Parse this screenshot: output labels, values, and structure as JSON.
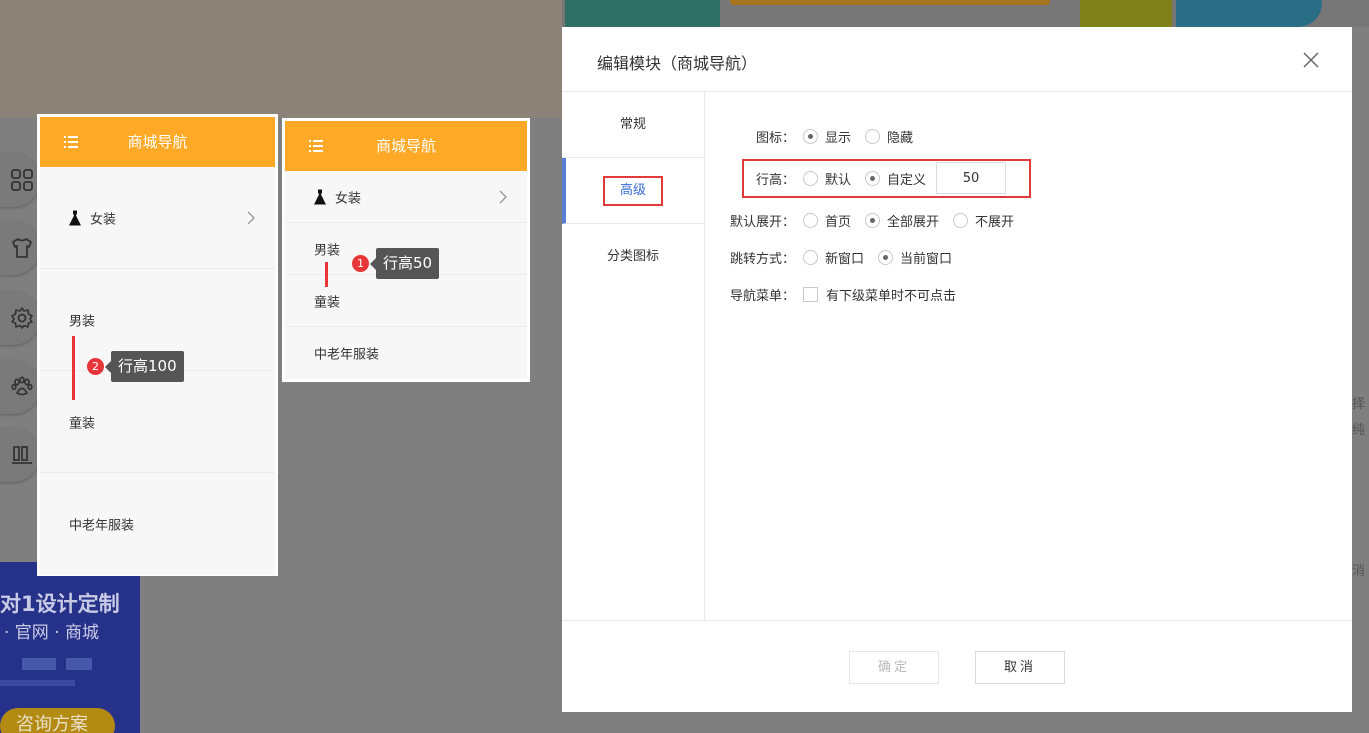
{
  "background": {
    "promo_title": "对1设计定制",
    "promo_sub": "· 官网    · 商城",
    "promo_button": "咨询方案",
    "edge_text": [
      "择",
      "纯",
      "消"
    ]
  },
  "preview_large": {
    "title": "商城导航",
    "items": [
      {
        "label": "女装",
        "has_icon": true,
        "has_arrow": true
      },
      {
        "label": "男装"
      },
      {
        "label": "童装"
      },
      {
        "label": "中老年服装"
      }
    ],
    "callout_num": "2",
    "callout_text": "行高100"
  },
  "preview_small": {
    "title": "商城导航",
    "items": [
      {
        "label": "女装",
        "has_icon": true,
        "has_arrow": true
      },
      {
        "label": "男装"
      },
      {
        "label": "童装"
      },
      {
        "label": "中老年服装"
      }
    ],
    "callout_num": "1",
    "callout_text": "行高50"
  },
  "dialog": {
    "title": "编辑模块（商城导航）",
    "tabs": [
      {
        "label": "常规",
        "active": false
      },
      {
        "label": "高级",
        "active": true
      },
      {
        "label": "分类图标",
        "active": false
      }
    ],
    "form": {
      "icon": {
        "label": "图标：",
        "options": [
          "显示",
          "隐藏"
        ],
        "selected": "显示"
      },
      "row_height": {
        "label": "行高：",
        "options": [
          "默认",
          "自定义"
        ],
        "selected": "自定义",
        "value": "50"
      },
      "default_expand": {
        "label": "默认展开：",
        "options": [
          "首页",
          "全部展开",
          "不展开"
        ],
        "selected": "全部展开"
      },
      "jump_mode": {
        "label": "跳转方式：",
        "options": [
          "新窗口",
          "当前窗口"
        ],
        "selected": "当前窗口"
      },
      "nav_menu": {
        "label": "导航菜单：",
        "checkbox_label": "有下级菜单时不可点击",
        "checked": false
      }
    },
    "buttons": {
      "ok": "确定",
      "cancel": "取消"
    }
  },
  "colors": {
    "nav_header": "#ffa927",
    "highlight": "#e03a3a",
    "active_tab": "#3a6bd6",
    "badge": "#e8353a"
  }
}
